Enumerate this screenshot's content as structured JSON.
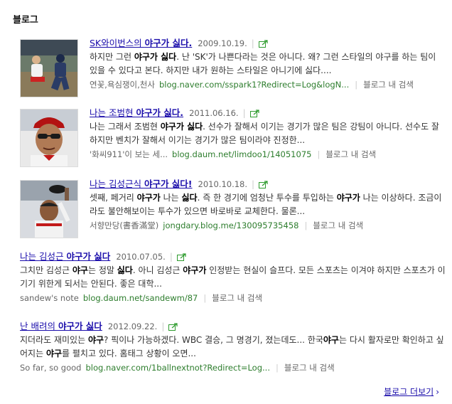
{
  "section_title": "블로그",
  "results": [
    {
      "title_pre": "SK와이번스의 ",
      "title_hl": "야구가 싫다.",
      "date": "2009.10.19.",
      "snippet": "하지만 그런 <b>야구가 싫다</b>. 난 'SK'가 나쁜다라는 것은 아니다. 왜? 그런 스타일의 야구를 하는 팀이 있을 수 있다고 본다. 하지만 내가 원하는 스타일은 아니기에 싫다....",
      "author": "연꽃,욕심쟁이,천사",
      "url": "blog.naver.com/sspark1?Redirect=Log&logN...",
      "blog_search": "블로그 내 검색",
      "thumb": "baseball-slide"
    },
    {
      "title_pre": "나는 조범현 ",
      "title_hl": "야구가 싫다.",
      "date": "2011.06.16.",
      "snippet": "나는 그래서 조범현 <b>야구가 싫다</b>. 선수가 잘해서 이기는 경기가 많은 팀은 강팀이 아니다. 선수도 잘하지만 벤치가 잘해서 이기는 경기가 많은 팀이라야 진정한...",
      "author": "'화씨911'이 보는 세...",
      "url": "blog.daum.net/limdoo1/14051075",
      "blog_search": "블로그 내 검색",
      "thumb": "manager-sunglasses"
    },
    {
      "title_pre": "나는 김성근식 ",
      "title_hl": "야구가 싫다!",
      "date": "2010.10.18.",
      "snippet": "셋째, 페거리 <b>야구가</b> 나는 <b>싫다</b>. 즉 한 경기에 엄청난 투수를 투입하는 <b>야구가</b> 나는 이상하다. 조금이라도 불안해보이는 투수가 있으면 바로바로 교체한다. 물론...",
      "author": "서향만당(書香滿堂)",
      "url": "jongdary.blog.me/130095735458",
      "blog_search": "블로그 내 검색",
      "thumb": "manager-cap"
    },
    {
      "title_pre": "나는 김성근 ",
      "title_hl": "야구가 싫다",
      "date": "2010.07.05.",
      "snippet": "그치만 김성근 <b>야구</b>는 정말 <b>싫다</b>. 아니 김성근 <b>야구가</b> 인정받는 현실이 슬프다. 모든 스포츠는 이겨야 하지만 스포츠가 이기기 위한게 되서는 안된다. 좋은 대학...",
      "author": "sandew's note",
      "url": "blog.daum.net/sandewm/87",
      "blog_search": "블로그 내 검색",
      "thumb": ""
    },
    {
      "title_pre": "난 배려의 ",
      "title_hl": "야구가 싫다",
      "date": "2012.09.22.",
      "snippet": "지더라도 재미있는 <b>야구</b>? 픽이나 가능하겠다. WBC 결승, 그 명경기, 졌는데도... 한국<b>야구</b>는 다시 활자로만 확인하고 싶어지는 <b>야구</b>를 펼치고 있다. 홈태그 상황이 오면...",
      "author": "So far, so good",
      "url": "blog.naver.com/1ballnextnot?Redirect=Log...",
      "blog_search": "블로그 내 검색",
      "thumb": ""
    }
  ],
  "more_link": "블로그 더보기",
  "more_chevron": "›"
}
